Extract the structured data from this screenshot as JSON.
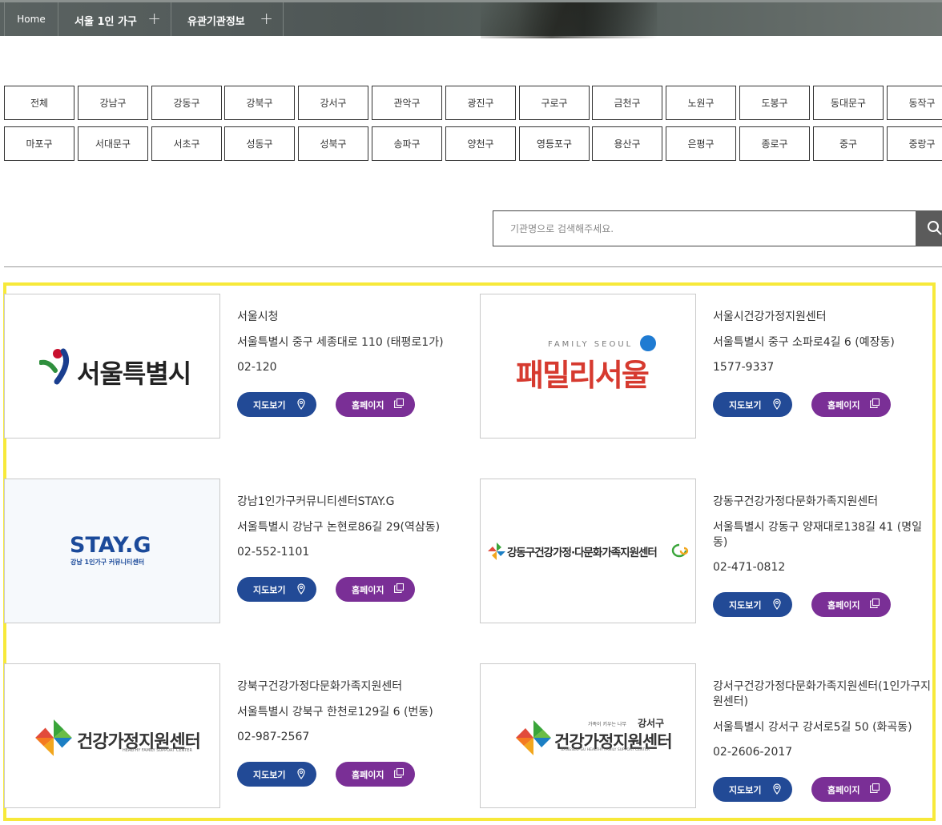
{
  "nav": {
    "home": "Home",
    "menu1": "서울 1인 가구",
    "menu2": "유관기관정보"
  },
  "districts": [
    "전체",
    "강남구",
    "강동구",
    "강북구",
    "강서구",
    "관악구",
    "광진구",
    "구로구",
    "금천구",
    "노원구",
    "도봉구",
    "동대문구",
    "동작구",
    "마포구",
    "서대문구",
    "서초구",
    "성동구",
    "성북구",
    "송파구",
    "양천구",
    "영등포구",
    "용산구",
    "은평구",
    "종로구",
    "중구",
    "중랑구"
  ],
  "search": {
    "placeholder": "기관명으로 검색해주세요."
  },
  "buttons": {
    "map": "지도보기",
    "homepage": "홈페이지"
  },
  "logos": {
    "seoul": "서울특별시",
    "family_seoul_top": "FAMILY SEOUL",
    "family_seoul": "패밀리서울",
    "stayg": "STAY.G",
    "stayg_sub": "강남 1인가구 커뮤니티센터",
    "gangdong": "강동구건강가정·다문화가족지원센터",
    "health_center": "건강가정지원센터",
    "health_center_en": "HEALTHY FAMILY SUPPORT CENTER",
    "gangseo_tag_small": "가족이 키우는 나무",
    "gangseo_tag": "강서구",
    "gangseo_en": "GANGSEO-GU HEALTHY FAMILY SUPPORT CENTER"
  },
  "orgs": [
    {
      "name": "서울시청",
      "address": "서울특별시 중구 세종대로 110 (태평로1가)",
      "phone": "02-120"
    },
    {
      "name": "서울시건강가정지원센터",
      "address": "서울특별시 중구 소파로4길 6 (예장동)",
      "phone": "1577-9337"
    },
    {
      "name": "강남1인가구커뮤니티센터STAY.G",
      "address": "서울특별시 강남구 논현로86길 29(역삼동)",
      "phone": "02-552-1101"
    },
    {
      "name": "강동구건강가정다문화가족지원센터",
      "address": "서울특별시 강동구 양재대로138길 41 (명일동)",
      "phone": "02-471-0812"
    },
    {
      "name": "강북구건강가정다문화가족지원센터",
      "address": "서울특별시 강북구 한천로129길 6 (번동)",
      "phone": "02-987-2567"
    },
    {
      "name": "강서구건강가정다문화가족지원센터(1인가구지원센터)",
      "address": "서울특별시 강서구 강서로5길 50 (화곡동)",
      "phone": "02-2606-2017"
    }
  ]
}
